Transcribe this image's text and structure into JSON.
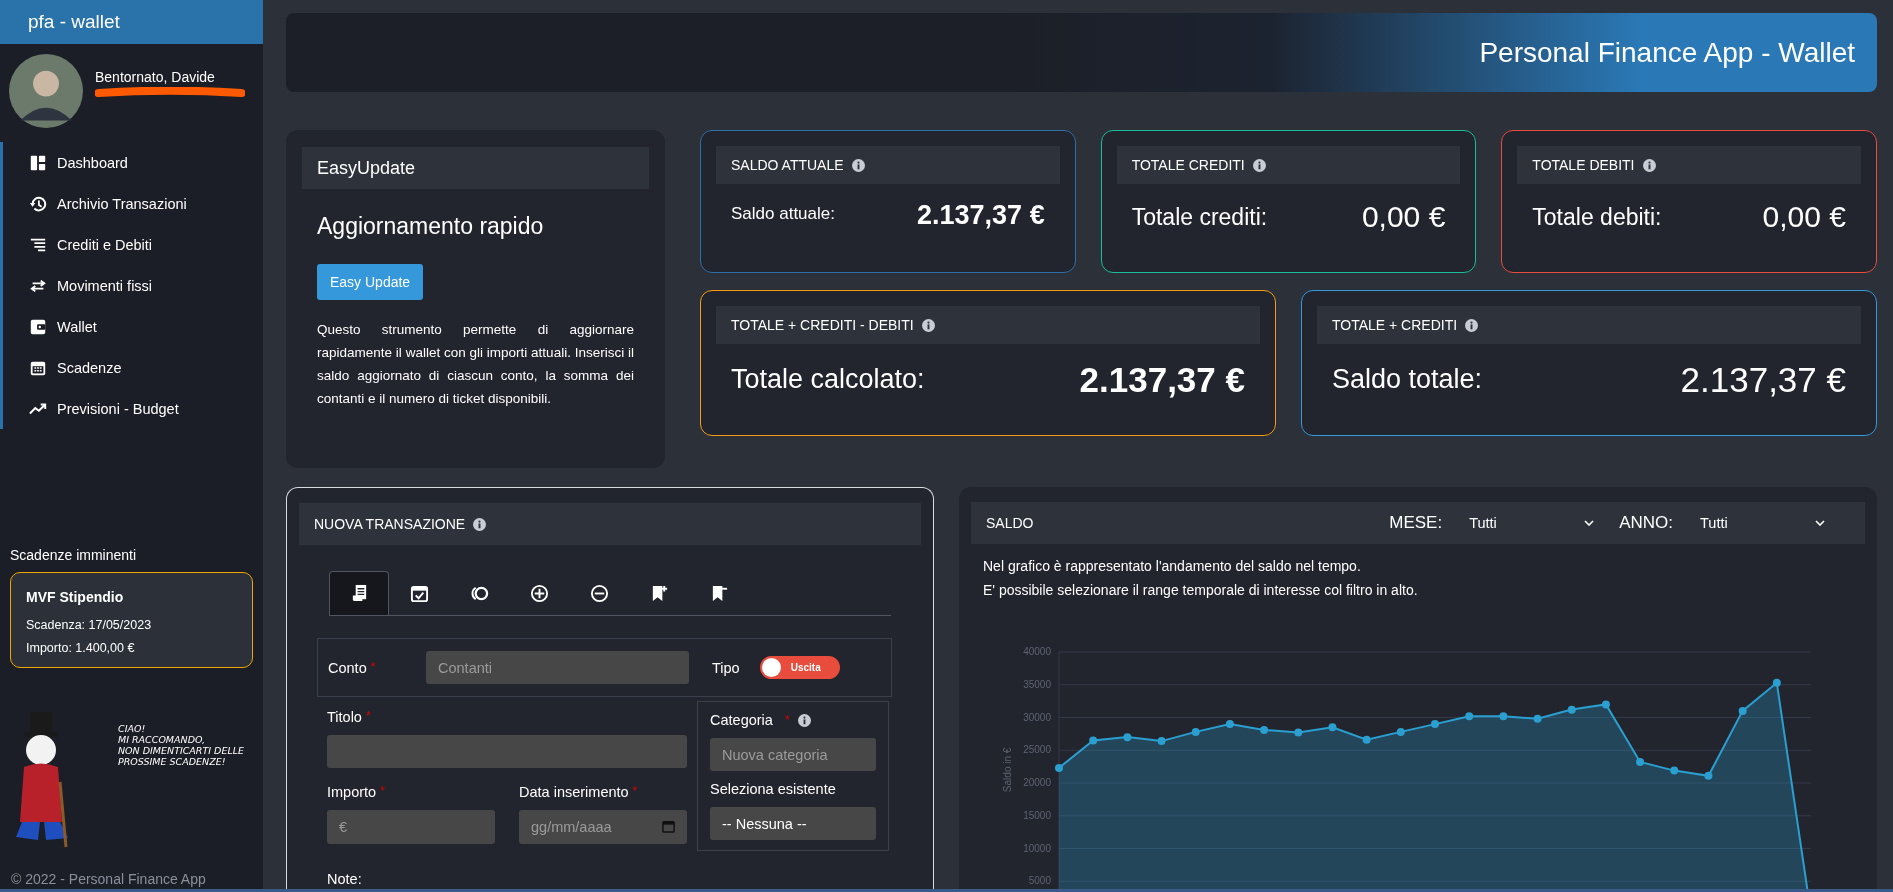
{
  "sidebar": {
    "brand": "pfa - wallet",
    "greeting": "Bentornato, Davide",
    "nav": [
      {
        "label": "Dashboard"
      },
      {
        "label": "Archivio Transazioni"
      },
      {
        "label": "Crediti e Debiti"
      },
      {
        "label": "Movimenti fissi"
      },
      {
        "label": "Wallet"
      },
      {
        "label": "Scadenze"
      },
      {
        "label": "Previsioni - Budget"
      }
    ],
    "deadlines_title": "Scadenze imminenti",
    "deadlines": [
      {
        "title": "MVF Stipendio",
        "due": "Scadenza: 17/05/2023",
        "amount": "Importo: 1.400,00 €"
      }
    ],
    "speech": [
      "CIAO!",
      "MI RACCOMANDO,",
      "NON DIMENTICARTI DELLE",
      "PROSSIME SCADENZE!"
    ],
    "footer": "© 2022 - Personal Finance App"
  },
  "header": {
    "title": "Personal Finance App - Wallet"
  },
  "easy_update": {
    "title": "EasyUpdate",
    "heading": "Aggiornamento rapido",
    "button": "Easy Update",
    "description": "Questo strumento permette di aggiornare rapidamente il wallet con gli importi attuali. Inserisci il saldo aggiornato di ciascun conto, la somma dei contanti e il numero di ticket disponibili."
  },
  "summary_cards": [
    {
      "title": "SALDO ATTUALE",
      "label": "Saldo attuale:",
      "value": "2.137,37 €",
      "color": "#2f6fa8",
      "bold": true
    },
    {
      "title": "TOTALE CREDITI",
      "label": "Totale crediti:",
      "value": "0,00 €",
      "color": "#1abc9c",
      "bold": false
    },
    {
      "title": "TOTALE DEBITI",
      "label": "Totale debiti:",
      "value": "0,00 €",
      "color": "#e74c3c",
      "bold": false
    },
    {
      "title": "TOTALE + CREDITI - DEBITI",
      "label": "Totale calcolato:",
      "value": "2.137,37 €",
      "color": "#f39c12",
      "bold": true
    },
    {
      "title": "TOTALE + CREDITI",
      "label": "Saldo totale:",
      "value": "2.137,37 €",
      "color": "#3498db",
      "bold": false
    }
  ],
  "new_transaction": {
    "title": "NUOVA TRANSAZIONE",
    "tabs": [
      {
        "selected": true
      },
      {
        "selected": false
      },
      {
        "selected": false
      },
      {
        "selected": false
      },
      {
        "selected": false
      },
      {
        "selected": false
      },
      {
        "selected": false
      }
    ],
    "account": {
      "label": "Conto",
      "required_mark": "*",
      "placeholder": "Contanti"
    },
    "type": {
      "label": "Tipo",
      "toggle": "Uscita",
      "on": false
    },
    "title_field": {
      "label": "Titolo",
      "required_mark": "*"
    },
    "category": {
      "label": "Categoria",
      "required_mark": "*",
      "placeholder": "Nuova categoria",
      "existing_label": "Seleziona esistente",
      "existing_value": "-- Nessuna --"
    },
    "amount": {
      "label": "Importo",
      "required_mark": "*",
      "placeholder": "€"
    },
    "date": {
      "label": "Data inserimento",
      "required_mark": "*",
      "placeholder": "gg/mm/aaaa"
    },
    "notes_label": "Note:"
  },
  "balance": {
    "title": "SALDO",
    "month_label": "MESE:",
    "month_value": "Tutti",
    "year_label": "ANNO:",
    "year_value": "Tutti",
    "description": [
      "Nel grafico è rappresentato l'andamento del saldo nel tempo.",
      "E' possibile selezionare il range temporale di interesse col filtro in alto."
    ],
    "chart_data": {
      "type": "area",
      "grid": true,
      "ylabel": "Saldo in €",
      "ylim": [
        0,
        40000
      ],
      "yticks": [
        5000,
        10000,
        15000,
        20000,
        25000,
        30000,
        35000,
        40000
      ],
      "series": [
        {
          "color": "#2a9fd0",
          "values": [
            22300,
            26500,
            27000,
            26400,
            27800,
            29000,
            28100,
            27700,
            28500,
            26600,
            27800,
            29000,
            30200,
            30200,
            29800,
            31200,
            32000,
            23200,
            21900,
            21100,
            31000,
            35300,
            0
          ]
        }
      ]
    }
  }
}
